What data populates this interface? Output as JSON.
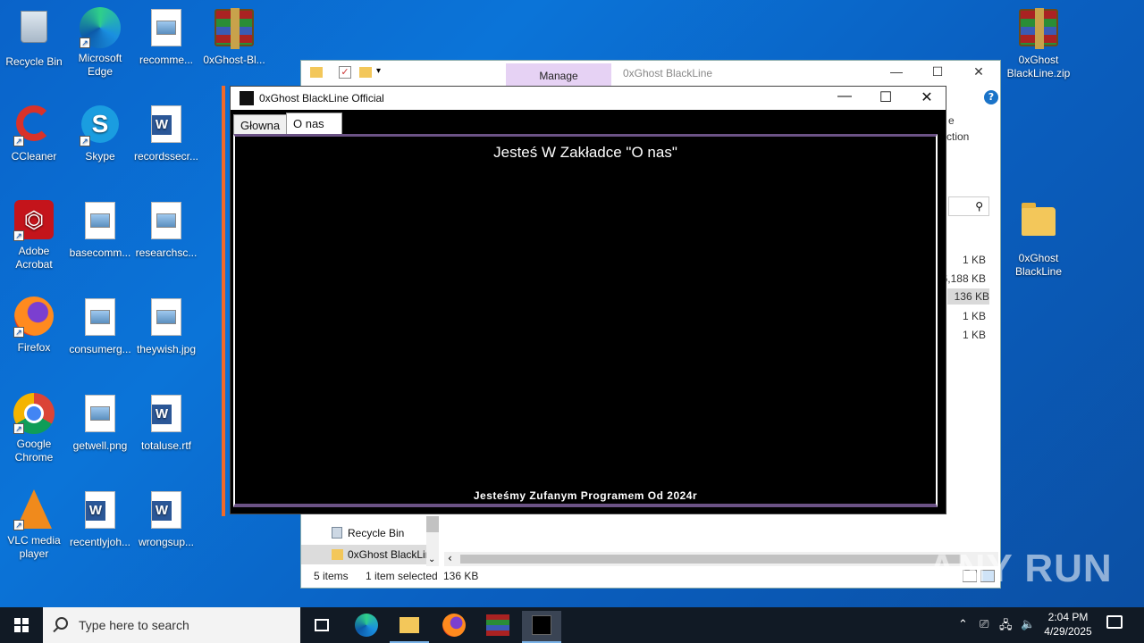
{
  "desktop": {
    "icons": [
      {
        "label": "Recycle Bin"
      },
      {
        "label": "Microsoft Edge"
      },
      {
        "label": "recomme..."
      },
      {
        "label": "0xGhost-Bl..."
      },
      {
        "label": "CCleaner"
      },
      {
        "label": "Skype"
      },
      {
        "label": "recordssecr..."
      },
      {
        "label": "Adobe Acrobat"
      },
      {
        "label": "basecomm..."
      },
      {
        "label": "researchsc..."
      },
      {
        "label": "Firefox"
      },
      {
        "label": "consumerg..."
      },
      {
        "label": "theywish.jpg"
      },
      {
        "label": "Google Chrome"
      },
      {
        "label": "getwell.png"
      },
      {
        "label": "totaluse.rtf"
      },
      {
        "label": "VLC media player"
      },
      {
        "label": "recentlyjoh..."
      },
      {
        "label": "wrongsup..."
      },
      {
        "label": "0xGhost BlackLine.zip"
      },
      {
        "label": "0xGhost BlackLine"
      }
    ]
  },
  "explorer": {
    "manage_tab": "Manage",
    "window_title": "0xGhost BlackLine",
    "ribbon_partial": [
      "e",
      "ction"
    ],
    "sizes": [
      "1 KB",
      "6,188 KB",
      "136 KB",
      "1 KB",
      "1 KB"
    ],
    "nav_items": [
      "Recycle Bin",
      "0xGhost BlackLine"
    ],
    "status": {
      "items": "5 items",
      "selected": "1 item selected",
      "size": "136 KB"
    }
  },
  "app": {
    "title": "0xGhost BlackLine Official",
    "tabs": [
      "Głowna",
      "O nas"
    ],
    "heading": "Jesteś W Zakładce \"O nas\"",
    "footer": "Jesteśmy Zufanym Programem Od 2024r"
  },
  "taskbar": {
    "search_placeholder": "Type here to search",
    "time": "2:04 PM",
    "date": "4/29/2025"
  },
  "watermark": "ANY RUN",
  "colors": {
    "accent_border": "#f06a2a",
    "purple_band": "#6b5285",
    "manage_tab": "#e6d2f4"
  }
}
